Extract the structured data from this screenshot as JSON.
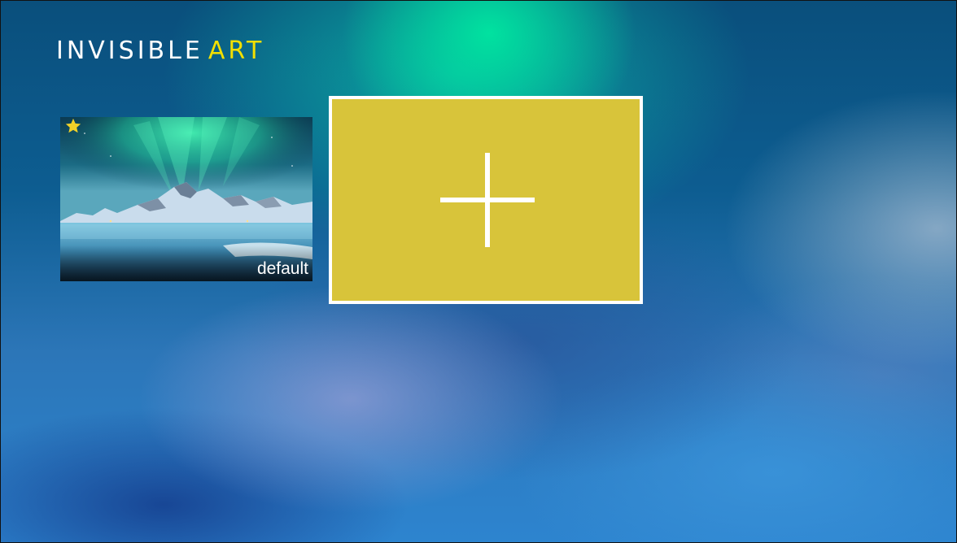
{
  "app": {
    "logo_word1": "INVISIBLE",
    "logo_word2": "ART"
  },
  "colors": {
    "accent_yellow": "#f3e000",
    "add_tile_fill": "#d8c43a",
    "star": "#f1d128"
  },
  "tiles": [
    {
      "label": "default",
      "thumbnail": "aurora-mountain-lake-image",
      "favorite_icon": "star-icon",
      "favorite": true
    },
    {
      "label": "",
      "icon": "plus-icon",
      "focused": true
    }
  ]
}
